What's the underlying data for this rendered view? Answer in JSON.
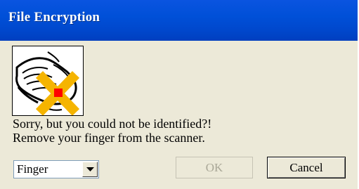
{
  "window": {
    "title": "File Encryption"
  },
  "message": {
    "line1": "Sorry, but you could not be identified?!",
    "line2": "Remove your finger from the scanner."
  },
  "credential_select": {
    "selected": "Finger"
  },
  "buttons": {
    "ok_label": "OK",
    "cancel_label": "Cancel"
  },
  "icons": {
    "status_graphic": "fingerprint-scan-fail-icon",
    "dropdown": "chevron-down-icon"
  },
  "colors": {
    "titlebar": "#0050d8",
    "dialog_bg": "#ece9d8",
    "fail_mark": "#f5b400",
    "fail_square": "#ff0000",
    "disabled_text": "#a9a797"
  }
}
